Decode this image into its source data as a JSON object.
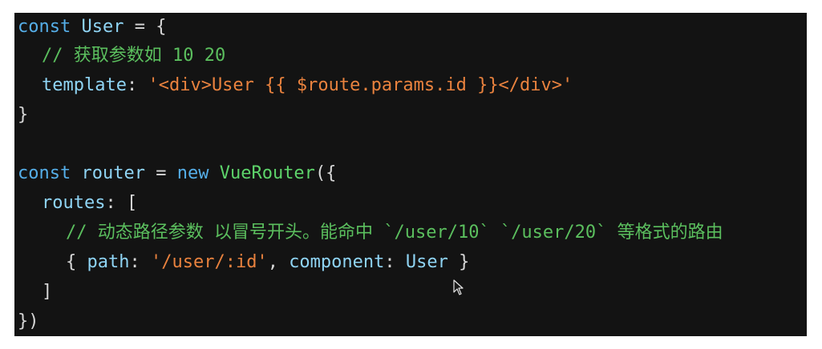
{
  "colors": {
    "background": "#131313",
    "keyword": "#55aee8",
    "identifier": "#8fd4f4",
    "string": "#e9823e",
    "class_name": "#5dd36a",
    "comment": "#5bbf5e",
    "punctuation": "#d7d7d7"
  },
  "code": {
    "line1": {
      "kw": "const",
      "ident": "User",
      "op": "=",
      "brace": "{"
    },
    "line2": {
      "comment": "// 获取参数如 10 20"
    },
    "line3": {
      "prop": "template",
      "colon": ":",
      "string": "'<div>User {{ $route.params.id }}</div>'"
    },
    "line4": {
      "brace": "}"
    },
    "line6": {
      "kw": "const",
      "ident": "router",
      "op": "=",
      "kw_new": "new",
      "cls": "VueRouter",
      "open": "({"
    },
    "line7": {
      "prop": "routes",
      "colon": ":",
      "bracket": "["
    },
    "line8": {
      "comment": "// 动态路径参数 以冒号开头。能命中 `/user/10` `/user/20` 等格式的路由"
    },
    "line9": {
      "open": "{",
      "path_key": "path",
      "colon1": ":",
      "path_val": "'/user/:id'",
      "comma": ",",
      "comp_key": "component",
      "colon2": ":",
      "comp_val": "User",
      "close": "}"
    },
    "line10": {
      "bracket": "]"
    },
    "line11": {
      "close": "})"
    }
  },
  "cursor_icon": "mouse-pointer-icon"
}
